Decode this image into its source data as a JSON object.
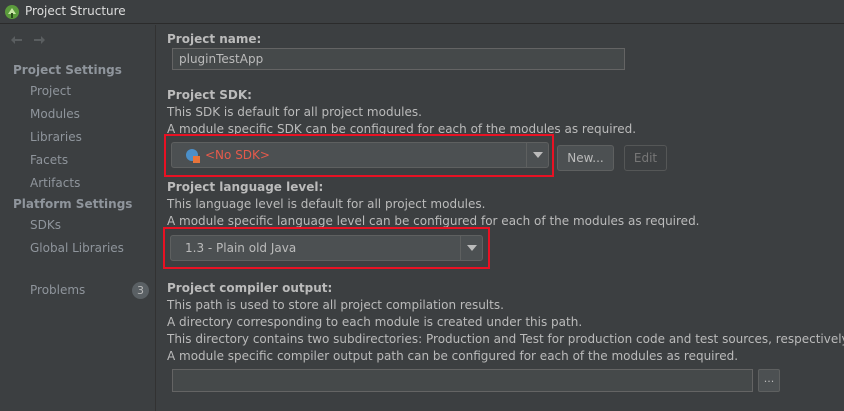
{
  "window": {
    "title": "Project Structure"
  },
  "sidebar": {
    "project_settings_header": "Project Settings",
    "project_items": [
      "Project",
      "Modules",
      "Libraries",
      "Facets",
      "Artifacts"
    ],
    "platform_settings_header": "Platform Settings",
    "platform_items": [
      "SDKs",
      "Global Libraries"
    ],
    "problems_label": "Problems",
    "problems_count": "3"
  },
  "main": {
    "project_name": {
      "label": "Project name:",
      "value": "pluginTestApp"
    },
    "project_sdk": {
      "label": "Project SDK:",
      "desc1": "This SDK is default for all project modules.",
      "desc2": "A module specific SDK can be configured for each of the modules as required.",
      "selected": "<No SDK>",
      "new_button": "New...",
      "edit_button": "Edit"
    },
    "language_level": {
      "label": "Project language level:",
      "desc1": "This language level is default for all project modules.",
      "desc2": "A module specific language level can be configured for each of the modules as required.",
      "selected": "1.3 - Plain old Java"
    },
    "compiler_output": {
      "label": "Project compiler output:",
      "desc1": "This path is used to store all project compilation results.",
      "desc2": "A directory corresponding to each module is created under this path.",
      "desc3": "This directory contains two subdirectories: Production and Test for production code and test sources, respectively.",
      "desc4": "A module specific compiler output path can be configured for each of the modules as required.",
      "value": "",
      "browse_button": "..."
    }
  },
  "colors": {
    "background": "#3c3f41",
    "text": "#bbbbbb",
    "sidebar_text": "#8f959c",
    "error_text": "#e55a4b",
    "highlight_box": "#e81123"
  }
}
